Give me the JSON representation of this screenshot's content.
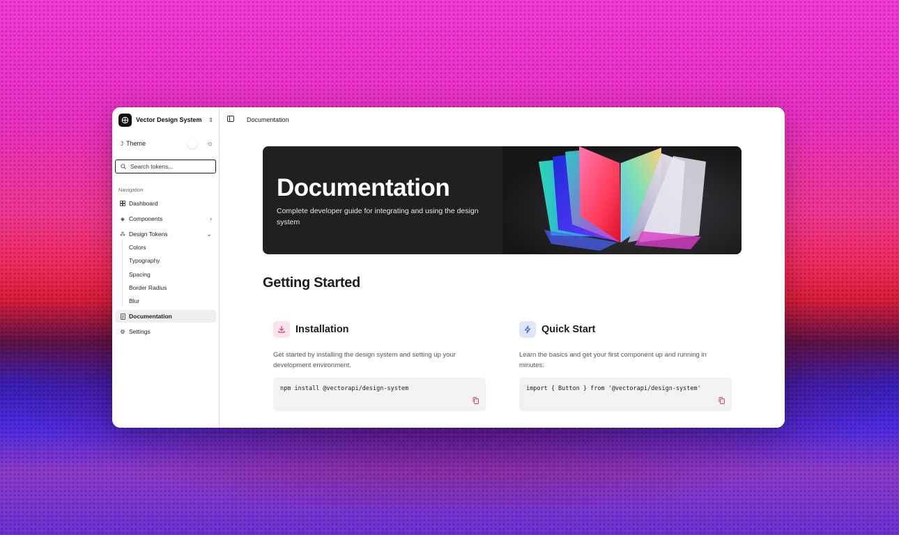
{
  "sidebar": {
    "workspace_name": "Vector Design System",
    "theme_label": "Theme",
    "search_placeholder": "Search tokens...",
    "nav_heading": "Navigation",
    "items": [
      {
        "label": "Dashboard",
        "icon": "grid-icon"
      },
      {
        "label": "Components",
        "icon": "diamond-icon",
        "expandable": true,
        "expanded": false
      },
      {
        "label": "Design Tokens",
        "icon": "tokens-icon",
        "expandable": true,
        "expanded": true
      },
      {
        "label": "Documentation",
        "icon": "document-icon",
        "active": true
      },
      {
        "label": "Settings",
        "icon": "gear-icon"
      }
    ],
    "token_subitems": [
      "Colors",
      "Typography",
      "Spacing",
      "Border Radius",
      "Blur"
    ]
  },
  "header": {
    "breadcrumb": "Documentation"
  },
  "hero": {
    "title": "Documentation",
    "subtitle": "Complete developer guide for integrating and using the design system"
  },
  "main": {
    "section_title": "Getting Started",
    "cards": [
      {
        "title": "Installation",
        "icon": "download-icon",
        "icon_color": "#e0356f",
        "description": "Get started by installing the design system and setting up your development environment.",
        "code": "npm install @vectorapi/design-system"
      },
      {
        "title": "Quick Start",
        "icon": "lightning-icon",
        "icon_color": "#3b66c9",
        "description": "Learn the basics and get your first component up and running in minutes.",
        "code": "import { Button } from '@vectorapi/design-system'"
      }
    ]
  },
  "colors": {
    "accent_pink": "#e0356f",
    "accent_blue": "#3b66c9",
    "hero_bg": "#202023",
    "code_bg": "#f2f2f4"
  }
}
